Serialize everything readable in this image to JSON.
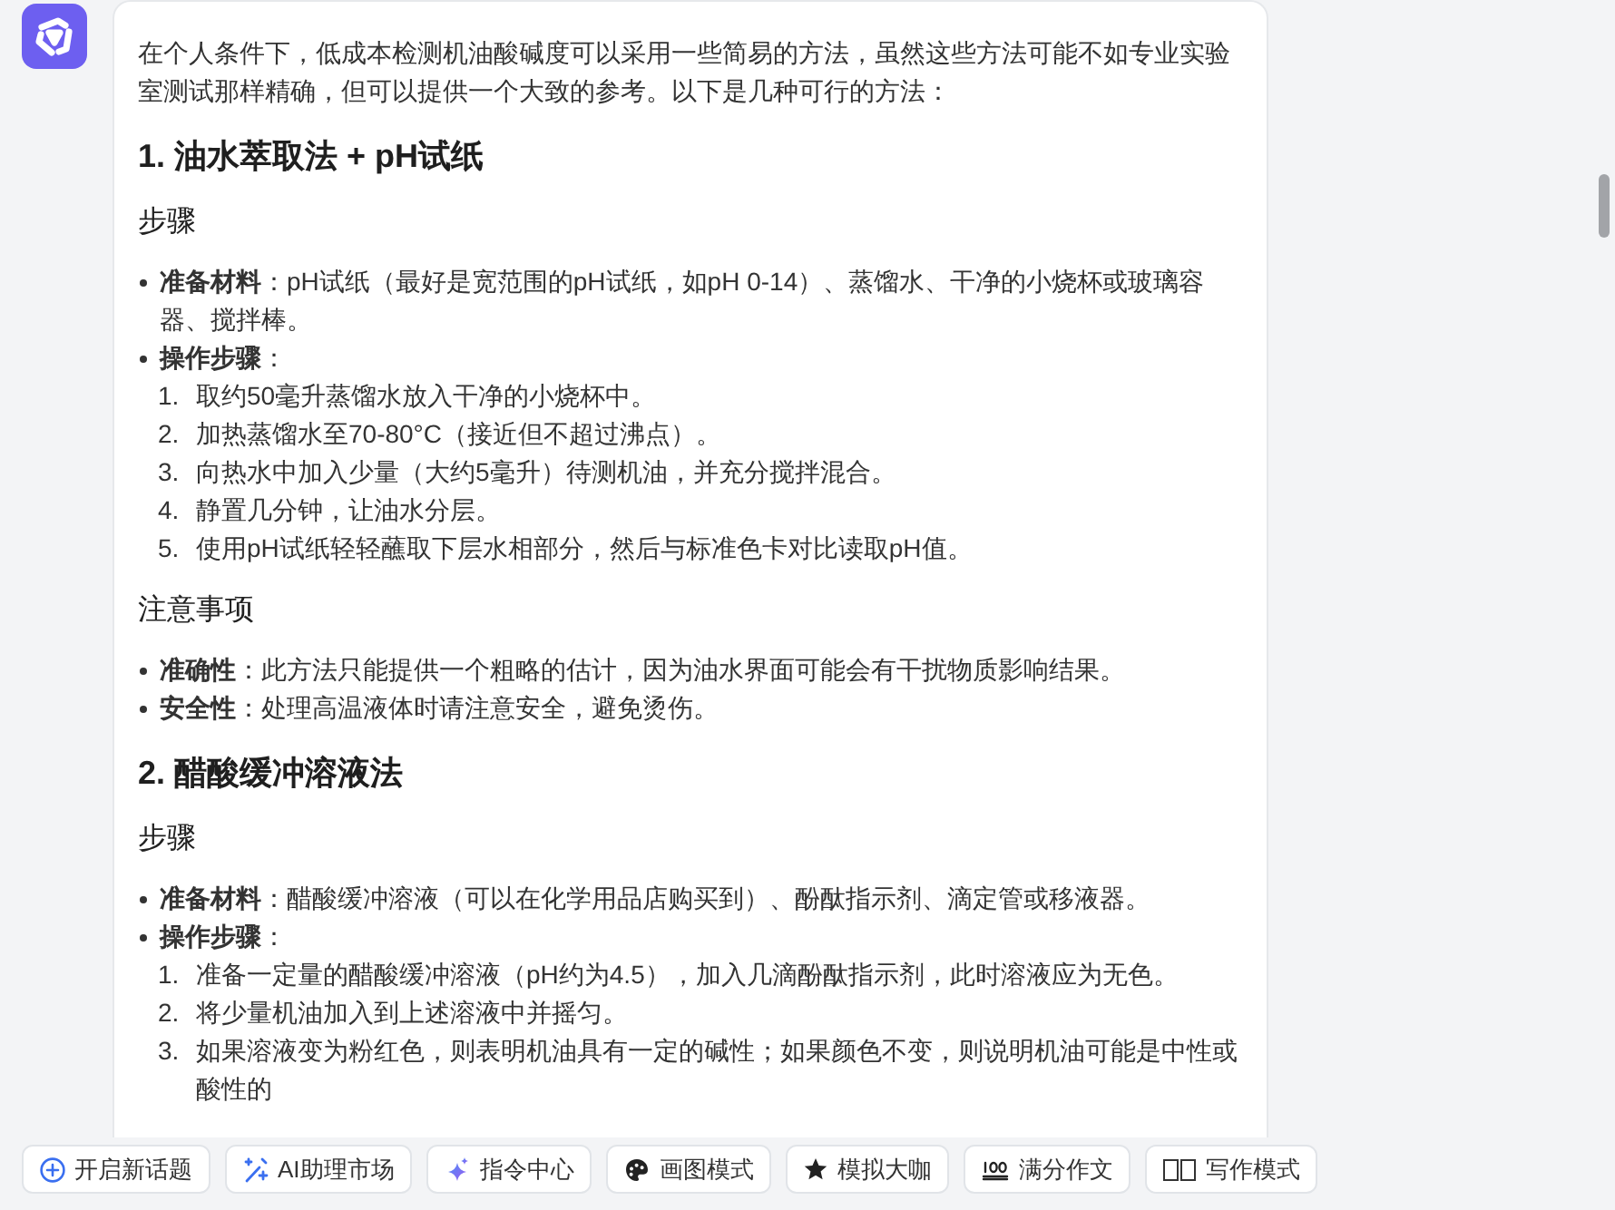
{
  "message": {
    "intro": "在个人条件下，低成本检测机油酸碱度可以采用一些简易的方法，虽然这些方法可能不如专业实验室测试那样精确，但可以提供一个大致的参考。以下是几种可行的方法：",
    "sections": [
      {
        "heading": "1. 油水萃取法 + pH试纸",
        "subsections": [
          {
            "heading": "步骤",
            "items": [
              {
                "text": "**准备材料**：pH试纸（最好是宽范围的pH试纸，如pH 0-14）、蒸馏水、干净的小烧杯或玻璃容器、搅拌棒。"
              },
              {
                "text": "**操作步骤**：",
                "children": [
                  {
                    "number": "1.",
                    "text": "取约50毫升蒸馏水放入干净的小烧杯中。"
                  },
                  {
                    "number": "2.",
                    "text": "加热蒸馏水至70-80°C（接近但不超过沸点）。"
                  },
                  {
                    "number": "3.",
                    "text": "向热水中加入少量（大约5毫升）待测机油，并充分搅拌混合。"
                  },
                  {
                    "number": "4.",
                    "text": "静置几分钟，让油水分层。"
                  },
                  {
                    "number": "5.",
                    "text": "使用pH试纸轻轻蘸取下层水相部分，然后与标准色卡对比读取pH值。"
                  }
                ]
              }
            ]
          },
          {
            "heading": "注意事项",
            "items": [
              {
                "text": "**准确性**：此方法只能提供一个粗略的估计，因为油水界面可能会有干扰物质影响结果。"
              },
              {
                "text": "**安全性**：处理高温液体时请注意安全，避免烫伤。"
              }
            ]
          }
        ]
      },
      {
        "heading": "2. 醋酸缓冲溶液法",
        "subsections": [
          {
            "heading": "步骤",
            "items": [
              {
                "text": "**准备材料**：醋酸缓冲溶液（可以在化学用品店购买到）、酚酞指示剂、滴定管或移液器。"
              },
              {
                "text": "**操作步骤**：",
                "children": [
                  {
                    "number": "1.",
                    "text": "准备一定量的醋酸缓冲溶液（pH约为4.5），加入几滴酚酞指示剂，此时溶液应为无色。"
                  },
                  {
                    "number": "2.",
                    "text": "将少量机油加入到上述溶液中并摇匀。"
                  },
                  {
                    "number": "3.",
                    "text": "如果溶液变为粉红色，则表明机油具有一定的碱性；如果颜色不变，则说明机油可能是中性或酸性的"
                  }
                ]
              }
            ]
          }
        ]
      }
    ]
  },
  "toolbar": {
    "buttons": [
      {
        "label": "开启新话题"
      },
      {
        "label": "AI助理市场"
      },
      {
        "label": "指令中心"
      },
      {
        "label": "画图模式"
      },
      {
        "label": "模拟大咖"
      },
      {
        "label": "满分作文"
      },
      {
        "label": "写作模式"
      }
    ]
  }
}
